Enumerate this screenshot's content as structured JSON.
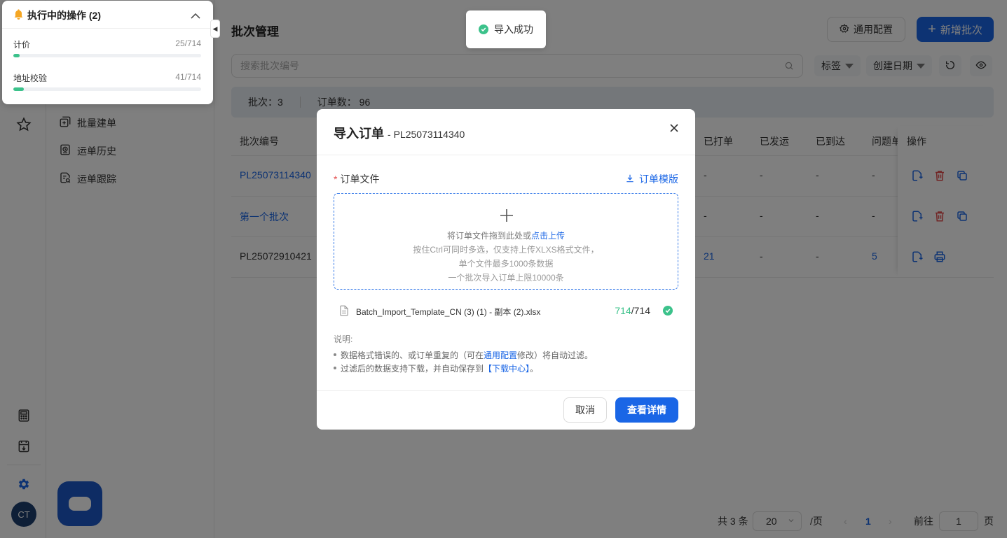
{
  "rail": {
    "avatar_text": "CT"
  },
  "submenu": {
    "items": [
      {
        "label": "批量建单",
        "icon": "batch-create-icon"
      },
      {
        "label": "运单历史",
        "icon": "history-icon"
      },
      {
        "label": "运单跟踪",
        "icon": "tracking-icon"
      }
    ]
  },
  "header": {
    "title": "批次管理",
    "config_label": "通用配置",
    "new_batch_label": "新增批次"
  },
  "search": {
    "placeholder": "搜索批次编号"
  },
  "filters": {
    "tags_label": "标签",
    "date_label": "创建日期"
  },
  "summary": {
    "batches": "批次：3",
    "orders": "订单数： 96"
  },
  "table": {
    "columns": [
      "批次编号",
      "已打单",
      "已发运",
      "已到达",
      "问题单",
      "操作"
    ],
    "rows": [
      {
        "batch": "PL25073114340",
        "printed": "-",
        "shipped": "-",
        "arrived": "-",
        "issues": "-",
        "actions": [
          "import",
          "delete",
          "copy"
        ]
      },
      {
        "batch": "第一个批次",
        "printed": "-",
        "shipped": "-",
        "arrived": "-",
        "issues": "-",
        "actions": [
          "import",
          "delete",
          "copy"
        ]
      },
      {
        "batch": "PL25072910421",
        "printed": "21",
        "shipped": "-",
        "arrived": "-",
        "issues": "5",
        "actions": [
          "import",
          "print"
        ]
      }
    ]
  },
  "pagination": {
    "total": "共 3 条",
    "page_size": "20",
    "per_page": "/页",
    "current": "1",
    "goto_label": "前往",
    "goto_value": "1",
    "page_suffix": "页"
  },
  "toast": {
    "text": "导入成功"
  },
  "ops_panel": {
    "title": "执行中的操作 (2)",
    "tasks": [
      {
        "name": "计价",
        "count": "25/714",
        "progress": 0.035
      },
      {
        "name": "地址校验",
        "count": "41/714",
        "progress": 0.057
      }
    ]
  },
  "modal": {
    "title": "导入订单",
    "subtitle": "- PL25073114340",
    "field_label": "订单文件",
    "template_link": "订单模版",
    "drop_text": "将订单文件拖到此处或",
    "drop_link": "点击上传",
    "drop_hint_1": "按住Ctrl可同时多选，仅支持上传XLXS格式文件，",
    "drop_hint_2": "单个文件最多1000条数据",
    "drop_hint_3": "一个批次导入订单上限10000条",
    "file_name": "Batch_Import_Template_CN (3) (1) - 副本 (2).xlsx",
    "file_ok_count": "714",
    "file_total": "/714",
    "note_title": "说明:",
    "note_1_pre": "数据格式错误的、或订单重复的（可在",
    "note_1_link": "通用配置",
    "note_1_post": "修改）将自动过滤。",
    "note_2_pre": "过滤后的数据支持下载，并自动保存到",
    "note_2_link": "【下载中心】",
    "note_2_post": "。",
    "cancel_label": "取消",
    "detail_label": "查看详情"
  },
  "colors": {
    "primary": "#1a66e6",
    "success": "#3cc28b",
    "danger": "#e34d4d",
    "warning": "#f5a623"
  }
}
